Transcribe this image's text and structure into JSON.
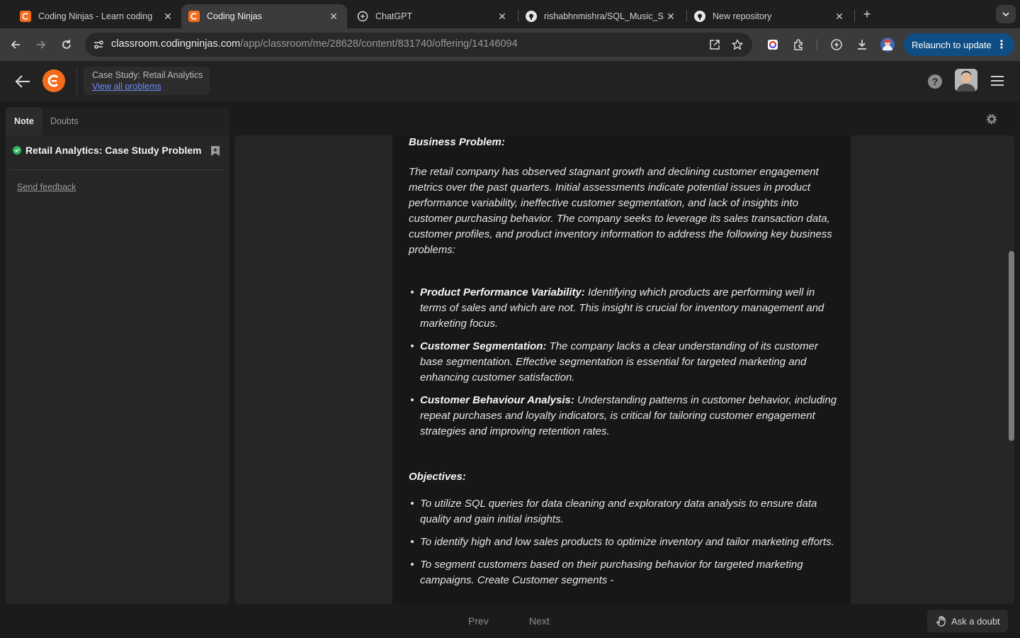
{
  "browser": {
    "tabs": [
      {
        "title": "Coding Ninjas - Learn coding",
        "favicon": "coding-ninjas-icon",
        "active": false
      },
      {
        "title": "Coding Ninjas",
        "favicon": "coding-ninjas-icon",
        "active": true
      },
      {
        "title": "ChatGPT",
        "favicon": "chatgpt-icon",
        "active": false
      },
      {
        "title": "rishabhnmishra/SQL_Music_S",
        "favicon": "github-icon",
        "active": false
      },
      {
        "title": "New repository",
        "favicon": "github-icon",
        "active": false
      }
    ],
    "url_host": "classroom.codingninjas.com",
    "url_path": "/app/classroom/me/28628/content/831740/offering/14146094",
    "relaunch_label": "Relaunch to update",
    "colors": {
      "accent": "#0f4e84",
      "brand": "#f66c1c"
    }
  },
  "header": {
    "course_title": "Case Study: Retail Analytics",
    "view_all_label": "View all problems",
    "help_symbol": "?"
  },
  "sidebar": {
    "tabs": [
      "Note",
      "Doubts"
    ],
    "problem_title": "Retail Analytics: Case Study Problem",
    "send_feedback": "Send feedback"
  },
  "article": {
    "business_heading": "Business Problem:",
    "intro": "The retail company has observed stagnant growth and declining customer engagement metrics over the past quarters. Initial assessments indicate potential issues in product performance variability, ineffective customer segmentation, and lack of insights into customer purchasing behavior. The company seeks to leverage its sales transaction data, customer profiles, and product inventory information to address the following key business problems:",
    "problems": [
      {
        "title": "Product Performance Variability:",
        "text": " Identifying which products are performing well in terms of sales and which are not. This insight is crucial for inventory management and marketing focus."
      },
      {
        "title": "Customer Segmentation:",
        "text": " The company lacks a clear understanding of its customer base segmentation. Effective segmentation is essential for targeted marketing and enhancing customer satisfaction."
      },
      {
        "title": "Customer Behaviour Analysis:",
        "text": " Understanding patterns in customer behavior, including repeat purchases and loyalty indicators, is critical for tailoring customer engagement strategies and improving retention rates."
      }
    ],
    "objectives_heading": "Objectives:",
    "objectives": [
      "To utilize SQL queries for data cleaning and exploratory data analysis to ensure data quality and gain initial insights.",
      "To identify high and low sales products to optimize inventory and tailor marketing efforts.",
      "To segment customers based on their purchasing behavior for targeted marketing campaigns. Create Customer segments -"
    ]
  },
  "footer": {
    "prev_label": "Prev",
    "next_label": "Next",
    "ask_label": "Ask a doubt"
  }
}
